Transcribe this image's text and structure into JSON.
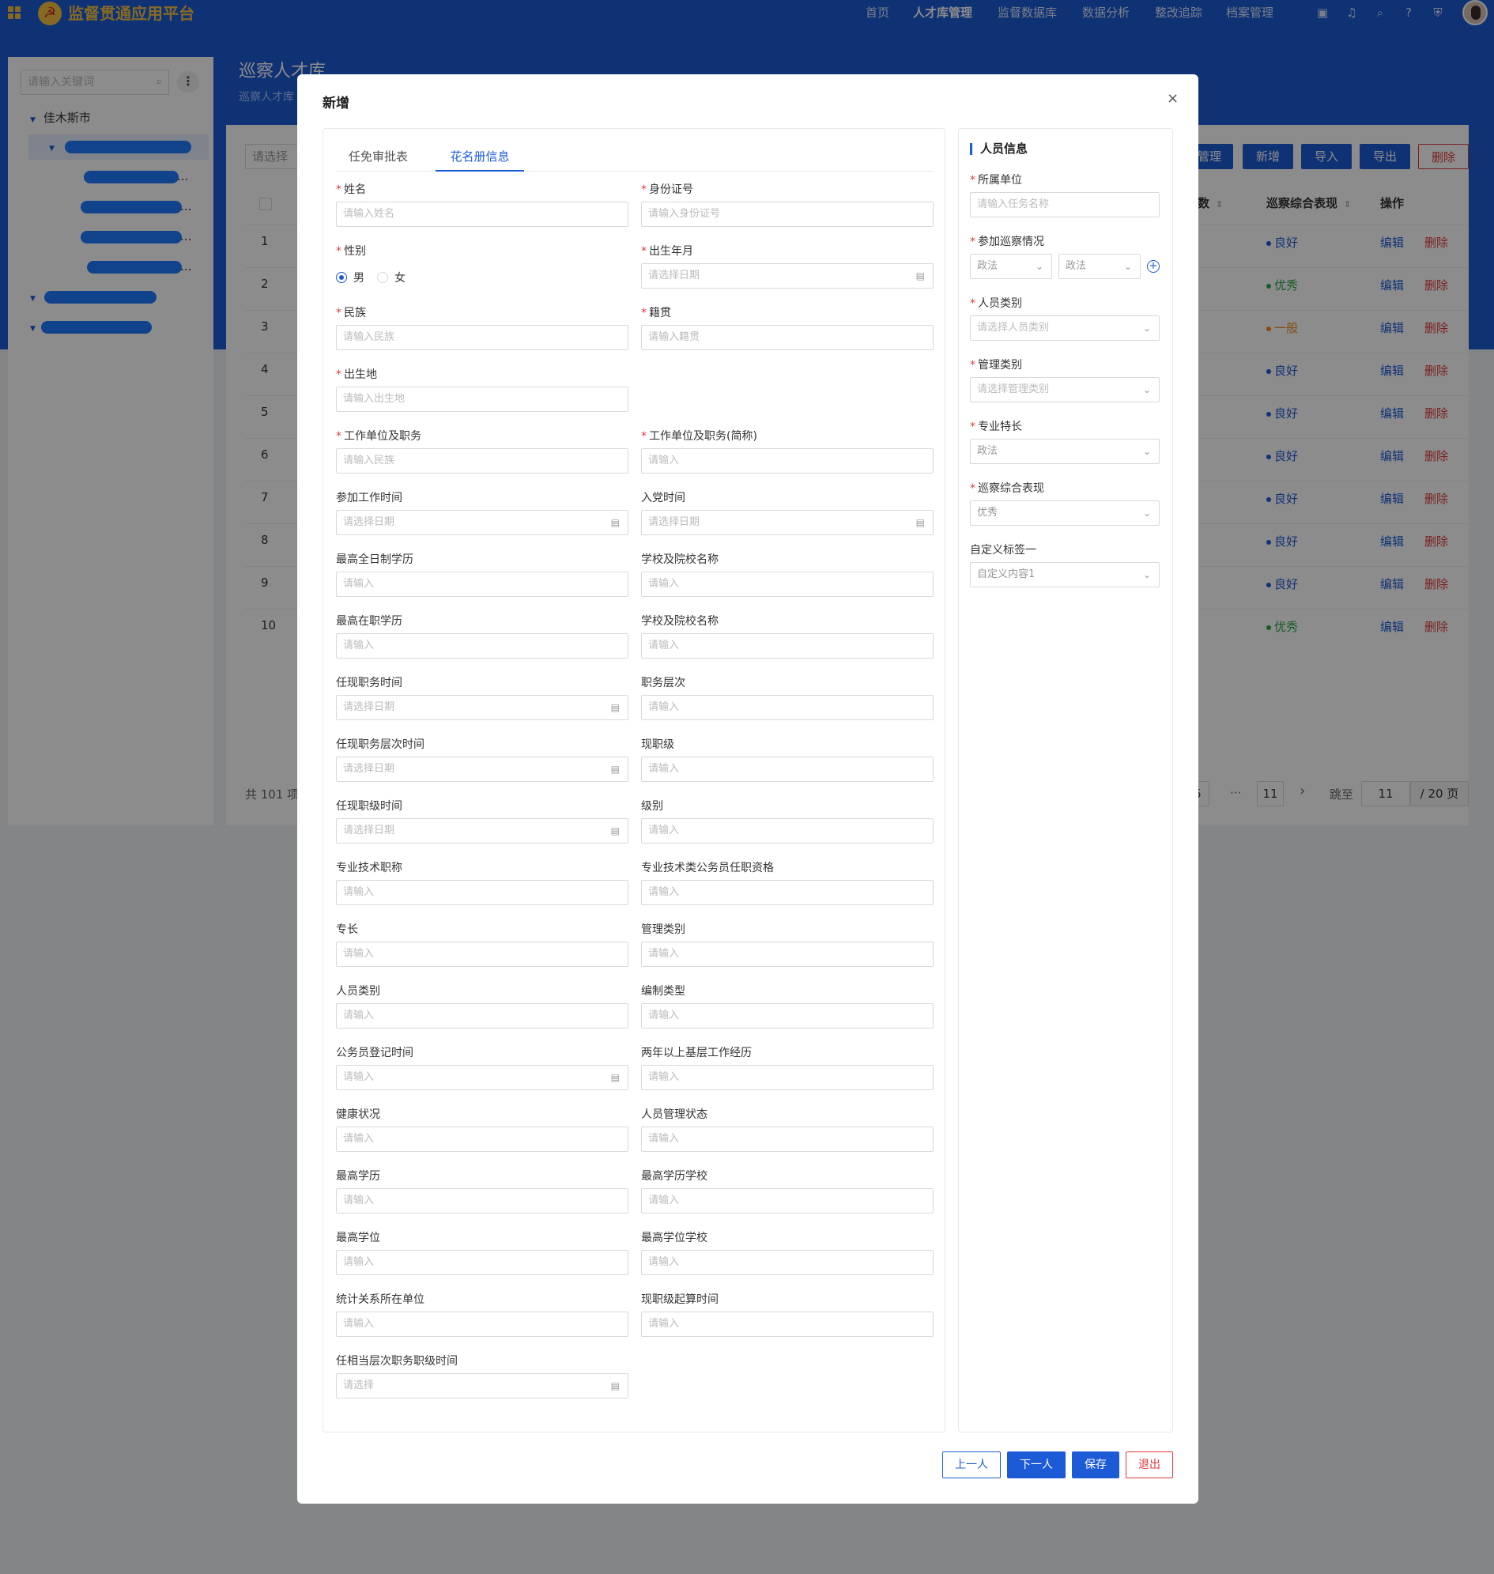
{
  "header": {
    "app_title": "监督贯通应用平台",
    "menu": [
      "首页",
      "人才库管理",
      "监督数据库",
      "数据分析",
      "整改追踪",
      "档案管理"
    ],
    "active_menu": "人才库管理"
  },
  "page": {
    "title": "巡察人才库",
    "subtitle": "巡察人才库"
  },
  "sidebar": {
    "search_placeholder": "请输入关键词",
    "root": "佳木斯市",
    "children_ellipsis": [
      "...",
      "...",
      "...",
      "..."
    ]
  },
  "toolbar": {
    "filter_placeholder": "请选择",
    "buttons": [
      "管理",
      "新增",
      "导入",
      "导出",
      "删除"
    ]
  },
  "table": {
    "headers": [
      "次数",
      "巡察综合表现",
      "操作"
    ],
    "rows": [
      {
        "num": "1",
        "rating": "良好",
        "color": "#1d5bd6"
      },
      {
        "num": "2",
        "rating": "优秀",
        "color": "#2ba54a"
      },
      {
        "num": "3",
        "rating": "一般",
        "color": "#f08a24"
      },
      {
        "num": "4",
        "rating": "良好",
        "color": "#1d5bd6"
      },
      {
        "num": "5",
        "rating": "良好",
        "color": "#1d5bd6"
      },
      {
        "num": "6",
        "rating": "良好",
        "color": "#1d5bd6"
      },
      {
        "num": "7",
        "rating": "良好",
        "color": "#1d5bd6"
      },
      {
        "num": "8",
        "rating": "良好",
        "color": "#1d5bd6"
      },
      {
        "num": "9",
        "rating": "良好",
        "color": "#1d5bd6"
      },
      {
        "num": "10",
        "rating": "优秀",
        "color": "#2ba54a"
      }
    ],
    "edit_label": "编辑",
    "delete_label": "删除"
  },
  "pagination": {
    "total": "共 101 项",
    "page_partial": "5",
    "ellipsis": "···",
    "last_page": "11",
    "next": "›",
    "jump_label": "跳至",
    "jump_value": "11",
    "total_pages": "/ 20 页"
  },
  "modal": {
    "title": "新增",
    "close": "×",
    "tabs": [
      "任免审批表",
      "花名册信息"
    ],
    "active_tab": "花名册信息",
    "form": {
      "name_label": "姓名",
      "name_ph": "请输入姓名",
      "id_label": "身份证号",
      "id_ph": "请输入身份证号",
      "gender_label": "性别",
      "gender_male": "男",
      "gender_female": "女",
      "birth_label": "出生年月",
      "birth_ph": "请选择日期",
      "ethnic_label": "民族",
      "ethnic_ph": "请输入民族",
      "native_label": "籍贯",
      "native_ph": "请输入籍贯",
      "birthplace_label": "出生地",
      "birthplace_ph": "请输入出生地",
      "work_label": "工作单位及职务",
      "work_ph": "请输入民族",
      "work_short_label": "工作单位及职务(简称)",
      "input_ph": "请输入",
      "date_ph": "请选择日期",
      "select_ph": "请选择",
      "join_work_label": "参加工作时间",
      "join_party_label": "入党时间",
      "edu_full_label": "最高全日制学历",
      "school1_label": "学校及院校名称",
      "edu_job_label": "最高在职学历",
      "school2_label": "学校及院校名称",
      "post_time_label": "任现职务时间",
      "post_level_label": "职务层次",
      "post_level_time_label": "任现职务层次时间",
      "rank_label": "现职级",
      "rank_time_label": "任现职级时间",
      "grade_label": "级别",
      "tech_title_label": "专业技术职称",
      "tech_qual_label": "专业技术类公务员任职资格",
      "specialty_label": "专长",
      "mgmt_type_label": "管理类别",
      "person_type_label": "人员类别",
      "staffing_label": "编制类型",
      "civil_reg_label": "公务员登记时间",
      "grassroots_label": "两年以上基层工作经历",
      "health_label": "健康状况",
      "status_label": "人员管理状态",
      "top_edu_label": "最高学历",
      "top_edu_school_label": "最高学历学校",
      "top_degree_label": "最高学位",
      "top_degree_school_label": "最高学位学校",
      "stat_unit_label": "统计关系所在单位",
      "rank_start_label": "现职级起算时间",
      "equiv_label": "任相当层次职务职级时间"
    },
    "person": {
      "title": "人员信息",
      "unit_label": "所属单位",
      "unit_ph": "请输入任务名称",
      "inspect_label": "参加巡察情况",
      "inspect_v1": "政法",
      "inspect_v2": "政法",
      "ptype_label": "人员类别",
      "ptype_ph": "请选择人员类别",
      "mtype_label": "管理类别",
      "mtype_ph": "请选择管理类别",
      "skill_label": "专业特长",
      "skill_value": "政法",
      "perf_label": "巡察综合表现",
      "perf_value": "优秀",
      "custom_label": "自定义标签一",
      "custom_value": "自定义内容1"
    },
    "footer": {
      "prev": "上一人",
      "next": "下一人",
      "save": "保存",
      "exit": "退出"
    }
  }
}
